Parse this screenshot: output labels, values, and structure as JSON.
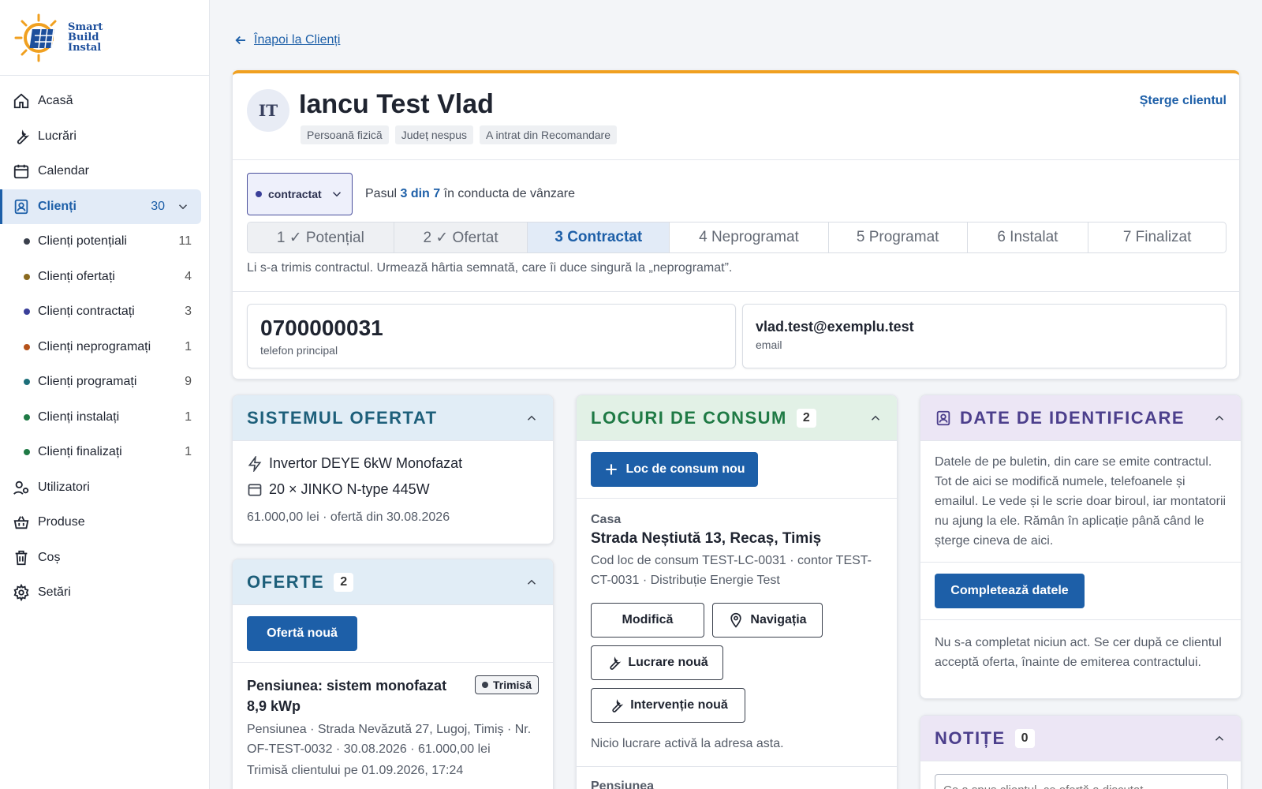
{
  "brand": {
    "line1": "Smart",
    "line2": "Build",
    "line3": "Instal"
  },
  "sidebar": {
    "items": [
      {
        "label": "Acasă"
      },
      {
        "label": "Lucrări"
      },
      {
        "label": "Calendar"
      },
      {
        "label": "Clienți",
        "count": "30"
      },
      {
        "label": "Utilizatori"
      },
      {
        "label": "Produse"
      },
      {
        "label": "Coș"
      },
      {
        "label": "Setări"
      }
    ],
    "subitems": [
      {
        "label": "Clienți potențiali",
        "count": "11",
        "color": "#3a404c"
      },
      {
        "label": "Clienți ofertați",
        "count": "4",
        "color": "#8a6a20"
      },
      {
        "label": "Clienți contractați",
        "count": "3",
        "color": "#3a3f99"
      },
      {
        "label": "Clienți neprogramați",
        "count": "1",
        "color": "#b5521a"
      },
      {
        "label": "Clienți programați",
        "count": "9",
        "color": "#1d6f7a"
      },
      {
        "label": "Clienți instalați",
        "count": "1",
        "color": "#1f7a45"
      },
      {
        "label": "Clienți finalizați",
        "count": "1",
        "color": "#1f7a45"
      }
    ]
  },
  "back": {
    "label": "Înapoi la Clienți"
  },
  "client": {
    "initials": "IT",
    "name": "Iancu Test Vlad",
    "tags": [
      "Persoană fizică",
      "Județ nespus",
      "A intrat din Recomandare"
    ],
    "delete_label": "Șterge clientul",
    "stage": "contractat",
    "step_prefix": "Pasul",
    "step_highlight": "3 din 7",
    "step_suffix": "în conducta de vânzare",
    "steps": [
      {
        "label": "1 ✓ Potențial"
      },
      {
        "label": "2 ✓ Ofertat"
      },
      {
        "label": "3 Contractat"
      },
      {
        "label": "4 Neprogramat"
      },
      {
        "label": "5 Programat"
      },
      {
        "label": "6 Instalat"
      },
      {
        "label": "7 Finalizat"
      }
    ],
    "step_note": "Li s-a trimis contractul. Urmează hârtia semnată, care îi duce singură la „neprogramat”.",
    "phone": "0700000031",
    "phone_label": "telefon principal",
    "email": "vlad.test@exemplu.test",
    "email_label": "email"
  },
  "system": {
    "title": "SISTEMUL OFERTAT",
    "inverter": "Invertor DEYE 6kW Monofazat",
    "panels": "20 × JINKO N-type 445W",
    "meta": "61.000,00 lei · ofertă din 30.08.2026"
  },
  "offers": {
    "title": "OFERTE",
    "count": "2",
    "new_label": "Ofertă nouă",
    "item_title": "Pensiunea: sistem monofazat 8,9 kWp",
    "item_status": "Trimisă",
    "item_meta": "Pensiunea · Strada Nevăzută 27, Lugoj, Timiș · Nr. OF-TEST-0032 · 30.08.2026 · 61.000,00 lei",
    "item_sent": "Trimisă clientului pe 01.09.2026, 17:24"
  },
  "locations": {
    "title": "LOCURI DE CONSUM",
    "count": "2",
    "new_label": "Loc de consum nou",
    "item_label": "Casa",
    "item_addr": "Strada Neștiută 13, Recaș, Timiș",
    "item_meta": "Cod loc de consum TEST-LC-0031 · contor TEST-CT-0031 · Distribuție Energie Test",
    "edit_label": "Modifică",
    "nav_label": "Navigația",
    "work_label": "Lucrare nouă",
    "intervention_label": "Intervenție nouă",
    "no_work": "Nicio lucrare activă la adresa asta.",
    "next_label": "Pensiunea"
  },
  "identification": {
    "title": "DATE DE IDENTIFICARE",
    "desc": "Datele de pe buletin, din care se emite contractul. Tot de aici se modifică numele, telefoanele și emailul. Le vede și le scrie doar biroul, iar montatorii nu ajung la ele. Rămân în aplicație până când le șterge cineva de aici.",
    "button": "Completează datele",
    "note": "Nu s-a completat niciun act. Se cer după ce clientul acceptă oferta, înainte de emiterea contractului."
  },
  "notes": {
    "title": "NOTIȚE",
    "count": "0",
    "placeholder": "Ce a spus clientul, ce ofertă a discutat..."
  }
}
